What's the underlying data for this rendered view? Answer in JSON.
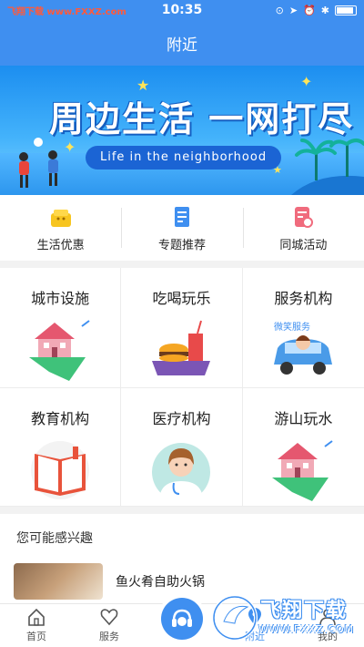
{
  "status_bar": {
    "watermark": "飞翔下载 www.FXXZ.com",
    "time": "10:35"
  },
  "header": {
    "title": "附近"
  },
  "banner": {
    "title": "周边生活 一网打尽",
    "subtitle": "Life in the neighborhood"
  },
  "quick_links": [
    {
      "label": "生活优惠",
      "icon": "gift-icon"
    },
    {
      "label": "专题推荐",
      "icon": "document-icon"
    },
    {
      "label": "同城活动",
      "icon": "activity-icon"
    }
  ],
  "categories": [
    {
      "label": "城市设施",
      "icon": "house-island-icon"
    },
    {
      "label": "吃喝玩乐",
      "icon": "food-tray-icon"
    },
    {
      "label": "服务机构",
      "icon": "car-service-icon",
      "art_text": "微笑服务"
    },
    {
      "label": "教育机构",
      "icon": "book-icon"
    },
    {
      "label": "医疗机构",
      "icon": "doctor-icon"
    },
    {
      "label": "游山玩水",
      "icon": "house-island-icon"
    }
  ],
  "interest": {
    "title": "您可能感兴趣",
    "items": [
      {
        "name": "鱼火肴自助火锅"
      }
    ]
  },
  "tabbar": {
    "items": [
      {
        "label": "首页",
        "icon": "home-icon"
      },
      {
        "label": "服务",
        "icon": "heart-icon"
      },
      {
        "label": "",
        "icon": "headset-icon"
      },
      {
        "label": "附近",
        "icon": "location-icon",
        "active": true
      },
      {
        "label": "我的",
        "icon": "user-icon"
      }
    ]
  },
  "watermark_logo": {
    "text": "飞翔下载",
    "url": "WWW.FXXZ.COM"
  },
  "colors": {
    "brand": "#3f8ff0",
    "banner_dark": "#1b64d4"
  }
}
